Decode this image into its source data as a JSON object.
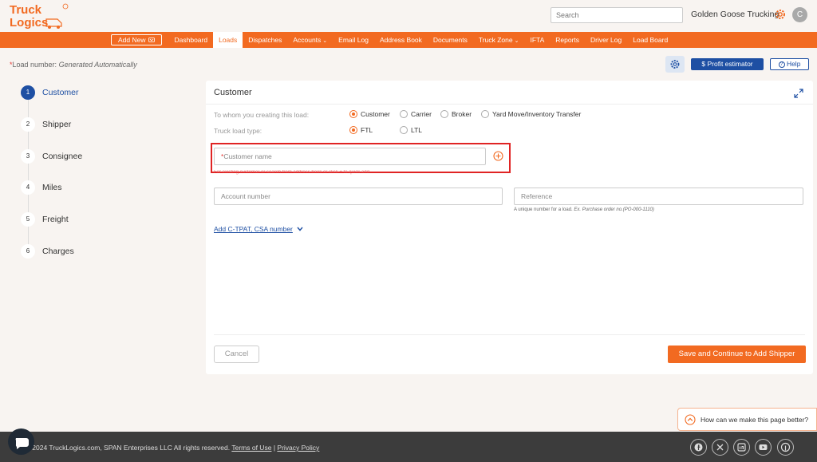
{
  "header": {
    "logo_text_line1": "Truck",
    "logo_text_line2": "Logics",
    "search_placeholder": "Search",
    "company_name": "Golden Goose Trucking",
    "avatar_initial": "C"
  },
  "nav": {
    "add_new": "Add New",
    "items": [
      "Dashboard",
      "Loads",
      "Dispatches",
      "Accounts",
      "Email Log",
      "Address Book",
      "Documents",
      "Truck Zone",
      "IFTA",
      "Reports",
      "Driver Log",
      "Load Board"
    ],
    "active": "Loads"
  },
  "subheader": {
    "load_number_req": "*",
    "load_number_label": "Load number:",
    "load_number_value": "Generated Automatically",
    "profit_estimator": "Profit estimator",
    "help": "Help"
  },
  "steps": [
    {
      "num": "1",
      "label": "Customer"
    },
    {
      "num": "2",
      "label": "Shipper"
    },
    {
      "num": "3",
      "label": "Consignee"
    },
    {
      "num": "4",
      "label": "Miles"
    },
    {
      "num": "5",
      "label": "Freight"
    },
    {
      "num": "6",
      "label": "Charges"
    }
  ],
  "form": {
    "title": "Customer",
    "whom_label": "To whom you creating this load:",
    "whom_options": [
      "Customer",
      "Carrier",
      "Broker",
      "Yard Move/Inventory Transfer"
    ],
    "whom_selected": "Customer",
    "load_type_label": "Truck load type:",
    "load_type_options": [
      "FTL",
      "LTL"
    ],
    "load_type_selected": "FTL",
    "customer_req": "*",
    "customer_placeholder": "Customer name",
    "customer_hint": "For existing customer or search from address book or click + to quick add",
    "account_placeholder": "Account number",
    "reference_placeholder": "Reference",
    "reference_hint_prefix": "A unique number for a load.",
    "reference_hint_example": "Ex. Purchase order no.(PO-000-1110)",
    "add_link": "Add C-TPAT, CSA number",
    "cancel": "Cancel",
    "save": "Save and Continue to Add Shipper"
  },
  "feedback": "How can we make this page better?",
  "footer": {
    "copyright": "©2024 TruckLogics.com, SPAN Enterprises LLC All rights reserved.",
    "terms": "Terms of Use",
    "separator": "|",
    "privacy": "Privacy Policy",
    "social": [
      "facebook-icon",
      "x-icon",
      "linkedin-icon",
      "youtube-icon",
      "pinterest-icon"
    ]
  },
  "colors": {
    "brand_orange": "#f26a21",
    "brand_blue": "#1e4fa3",
    "highlight_red": "#e02424"
  }
}
